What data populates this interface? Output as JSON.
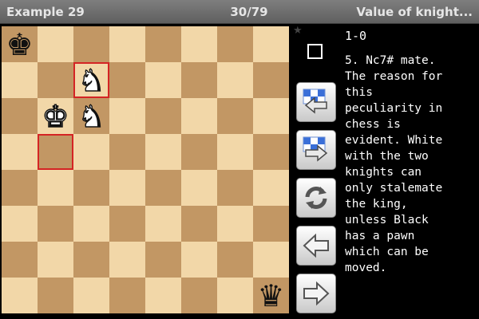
{
  "header": {
    "title_left": "Example 29",
    "title_center": "30/79",
    "title_right": "Value of knight..."
  },
  "board": {
    "pieces": [
      {
        "square": "a8",
        "glyph": "♚",
        "color": "black",
        "name": "black-king"
      },
      {
        "square": "c7",
        "glyph": "♞",
        "color": "white",
        "name": "white-knight"
      },
      {
        "square": "b6",
        "glyph": "♚",
        "color": "white",
        "name": "white-king"
      },
      {
        "square": "c6",
        "glyph": "♞",
        "color": "white",
        "name": "white-knight"
      },
      {
        "square": "h1",
        "glyph": "♛",
        "color": "black",
        "name": "black-queen"
      }
    ],
    "highlighted_squares": [
      "c7",
      "b5"
    ],
    "light_color": "#f2d7a8",
    "dark_color": "#c29764",
    "highlight_color": "#d42424"
  },
  "panel": {
    "star_glyph": "★",
    "result": "1-0",
    "comment_lines": [
      "5. Nc7# mate.",
      "The reason for",
      "this",
      "peculiarity in",
      "chess is",
      "evident. White",
      "with the two",
      "knights can",
      "only stalemate",
      "the king,",
      "unless Black",
      "has a pawn",
      "which can be",
      "moved."
    ]
  },
  "controls": [
    {
      "name": "previous-game-button",
      "icon": "board-arrow-left-icon"
    },
    {
      "name": "next-game-button",
      "icon": "board-arrow-right-icon"
    },
    {
      "name": "flip-board-button",
      "icon": "refresh-icon"
    },
    {
      "name": "previous-move-button",
      "icon": "arrow-left-icon"
    },
    {
      "name": "next-move-button",
      "icon": "arrow-right-icon"
    }
  ]
}
